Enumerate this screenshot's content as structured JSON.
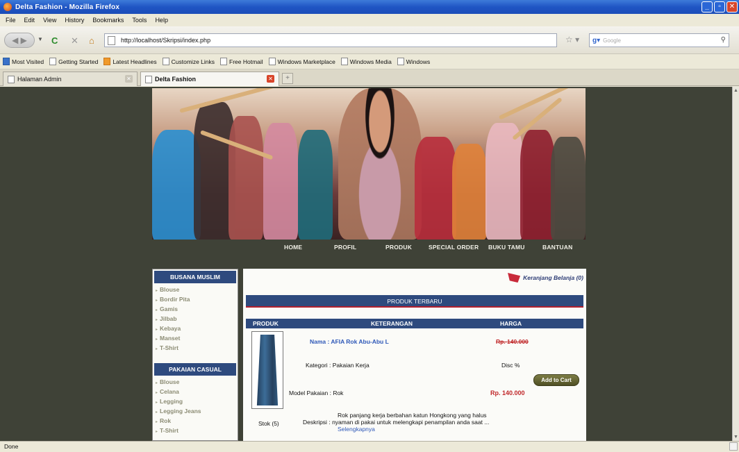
{
  "window": {
    "title": "Delta Fashion - Mozilla Firefox"
  },
  "menu": [
    "File",
    "Edit",
    "View",
    "History",
    "Bookmarks",
    "Tools",
    "Help"
  ],
  "toolbar": {
    "url": "http://localhost/Skripsi/index.php",
    "search_placeholder": "Google"
  },
  "bookmarks": [
    "Most Visited",
    "Getting Started",
    "Latest Headlines",
    "Customize Links",
    "Free Hotmail",
    "Windows Marketplace",
    "Windows Media",
    "Windows"
  ],
  "tabs": [
    {
      "label": "Halaman Admin"
    },
    {
      "label": "Delta Fashion"
    }
  ],
  "site": {
    "nav": [
      "HOME",
      "PROFIL",
      "PRODUK",
      "SPECIAL ORDER",
      "BUKU TAMU",
      "BANTUAN"
    ],
    "sidebar": {
      "categories": [
        {
          "title": "BUSANA MUSLIM",
          "items": [
            "Blouse",
            "Bordir Pita",
            "Gamis",
            "Jilbab",
            "Kebaya",
            "Manset",
            "T-Shirt"
          ]
        },
        {
          "title": "PAKAIAN CASUAL",
          "items": [
            "Blouse",
            "Celana",
            "Legging",
            "Legging Jeans",
            "Rok",
            "T-Shirt"
          ]
        }
      ]
    },
    "cart_label": "Keranjang Belanja (0)",
    "section_title": "PRODUK TERBARU",
    "table_headers": [
      "PRODUK",
      "KETERANGAN",
      "HARGA"
    ],
    "product": {
      "name": "Nama : AFIA Rok Abu-Abu L",
      "old_price": "Rp. 140.000",
      "category": "Kategori : Pakaian Kerja",
      "discount": "Disc %",
      "add_to_cart": "Add to Cart",
      "model": "Model Pakaian : Rok",
      "price": "Rp. 140.000",
      "stock": "Stok (5)",
      "desc_label": "Deskripsi :",
      "desc_line1": "Rok panjang kerja berbahan katun Hongkong yang halus",
      "desc_line2": "nyaman di pakai untuk melengkapi penampilan anda saat ...",
      "desc_more": "Selengkapnya"
    }
  },
  "status": {
    "text": "Done"
  },
  "colors": {
    "page_bg": "#3f4237",
    "header_blue": "#2e4a7e",
    "accent_red": "#c0282a"
  }
}
